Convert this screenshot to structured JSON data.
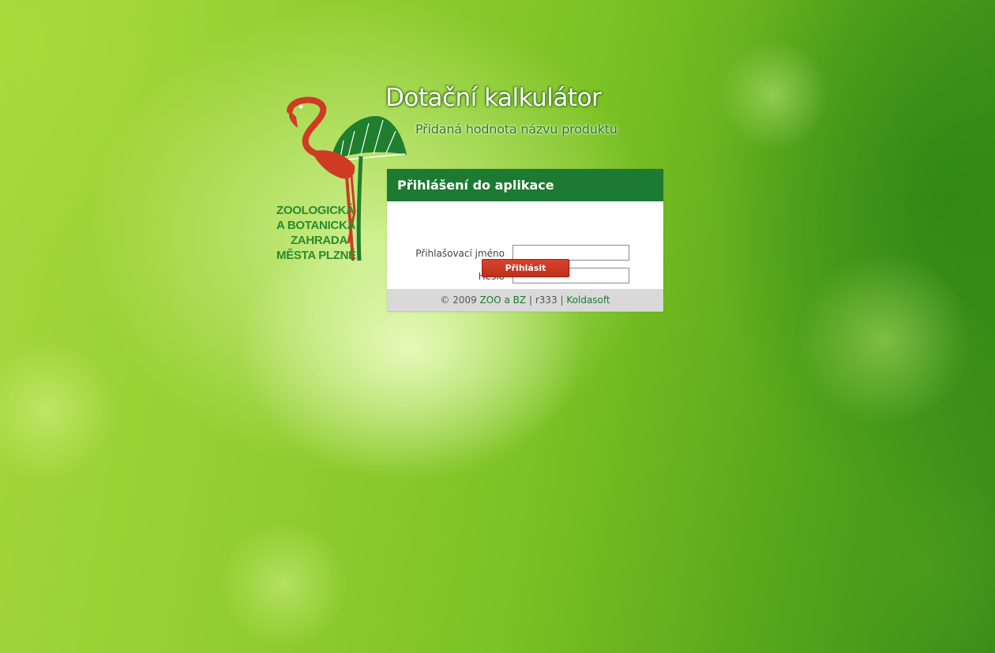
{
  "logo": {
    "lines": [
      "ZOOLOGICKÁ",
      "A BOTANICKÁ",
      "ZAHRADA",
      "MĚSTA PLZNĚ"
    ],
    "colors": {
      "flamingo": "#cf3b25",
      "leaf": "#1f7f2e",
      "text": "#2c8a2e"
    }
  },
  "header": {
    "title": "Dotační kalkulátor",
    "subtitle": "Přidaná hodnota názvu produktu"
  },
  "login": {
    "title": "Přihlášení do aplikace",
    "username_label": "Přihlašovací jméno",
    "username_value": "",
    "password_label": "Heslo",
    "password_value": "",
    "submit_label": "Přihlásit"
  },
  "footer": {
    "copyright": "© 2009",
    "link1": "ZOO a BZ",
    "sep1": "|",
    "revision": "r333",
    "sep2": "|",
    "link2": "Koldasoft"
  },
  "colors": {
    "header_bg": "#1d7a32",
    "button_bg": "#cc3a24",
    "footer_bg": "#d9d9d9",
    "link": "#1d7a32"
  }
}
